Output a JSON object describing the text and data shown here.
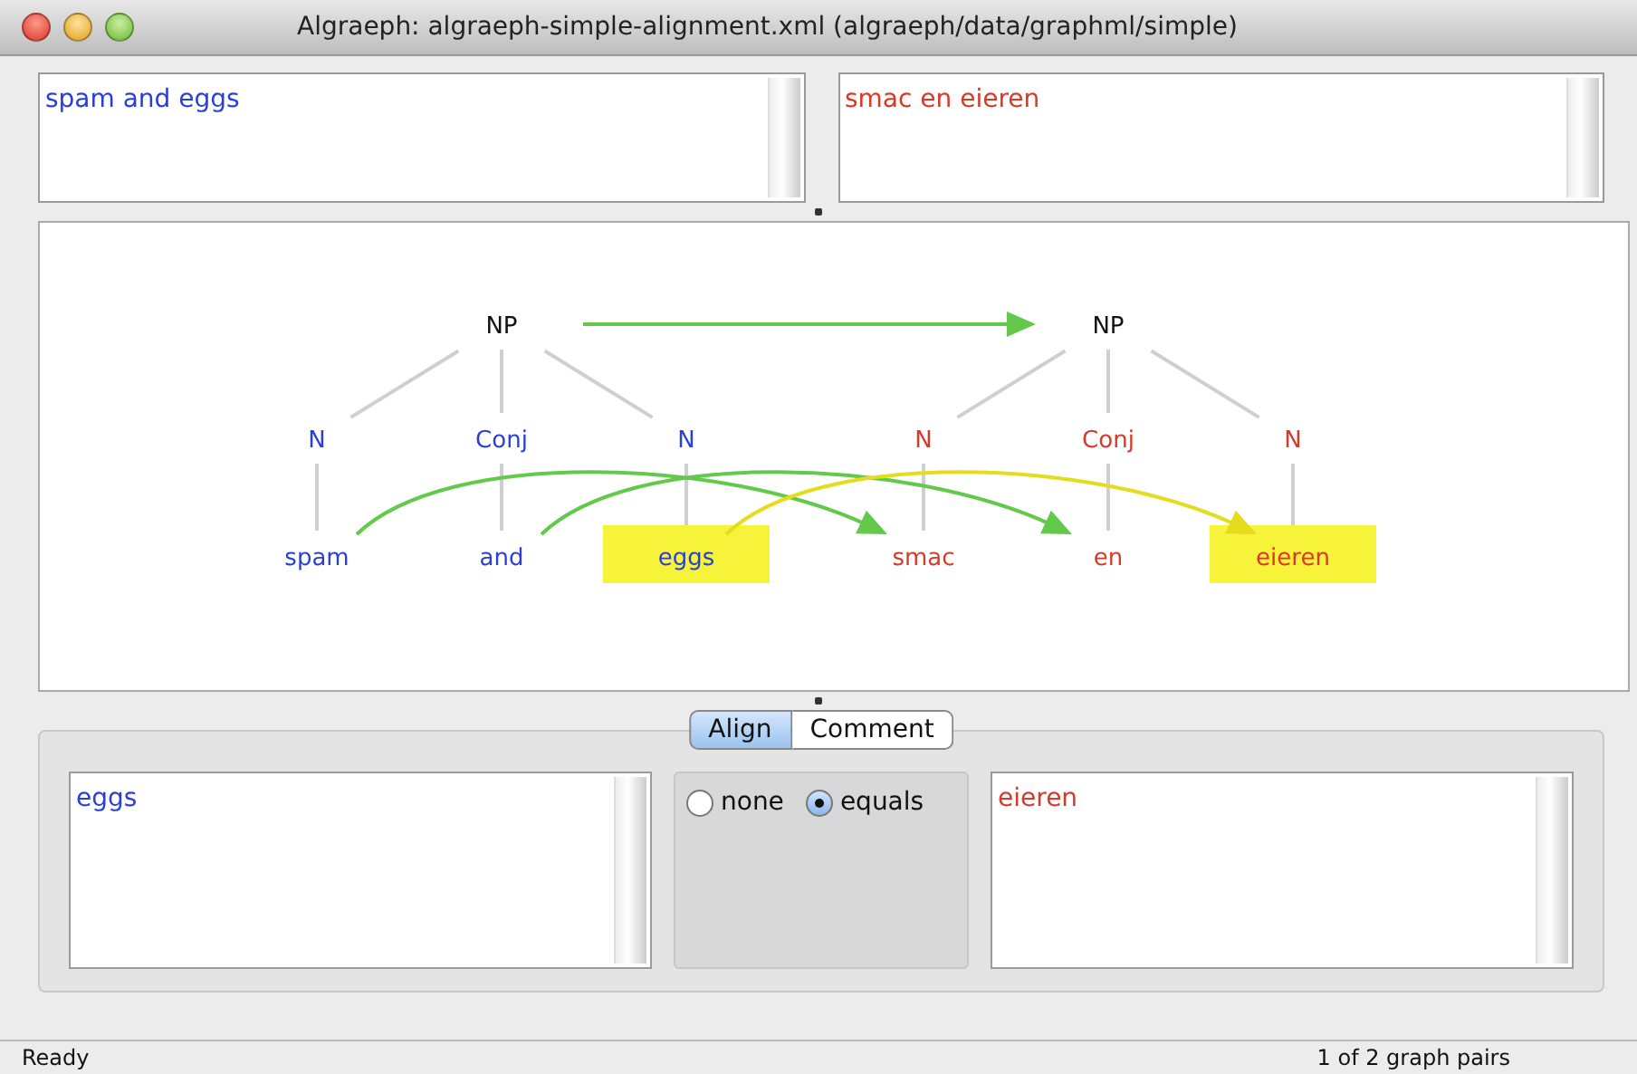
{
  "window": {
    "title": "Algraeph:  algraeph-simple-alignment.xml  (algraeph/data/graphml/simple)"
  },
  "sentences": [
    {
      "kind": "source",
      "text": "spam and eggs"
    },
    {
      "kind": "target",
      "text": "smac en eieren"
    }
  ],
  "graph": {
    "trees": [
      {
        "kind": "source",
        "root": {
          "label": "NP",
          "aligned": {
            "selected": false
          },
          "children": [
            {
              "label": "N",
              "children": [
                {
                  "label": "spam",
                  "aligned": {
                    "selected": false
                  }
                }
              ]
            },
            {
              "label": "Conj",
              "children": [
                {
                  "label": "and",
                  "aligned": {
                    "selected": false
                  }
                }
              ]
            },
            {
              "label": "N",
              "children": [
                {
                  "label": "eggs",
                  "aligned": {
                    "selected": true
                  }
                }
              ]
            }
          ]
        }
      },
      {
        "kind": "target",
        "root": {
          "label": "NP",
          "children": [
            {
              "label": "N",
              "children": [
                {
                  "label": "smac"
                }
              ]
            },
            {
              "label": "Conj",
              "children": [
                {
                  "label": "en"
                }
              ]
            },
            {
              "label": "N",
              "children": [
                {
                  "label": "eieren"
                }
              ]
            }
          ]
        }
      }
    ]
  },
  "tabs": [
    {
      "label": "Align",
      "selected": true
    },
    {
      "label": "Comment",
      "selected": false
    }
  ],
  "selection": [
    {
      "kind": "source",
      "text": "eggs"
    },
    {
      "kind": "target",
      "text": "eieren"
    }
  ],
  "relations": [
    {
      "label": "none",
      "selected": false
    },
    {
      "label": "equals",
      "selected": true
    }
  ],
  "status_bar": {
    "message": "Ready",
    "pairs": "1 of 2 graph pairs"
  }
}
